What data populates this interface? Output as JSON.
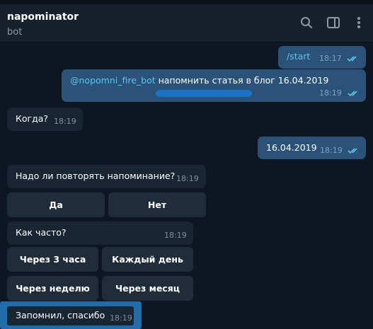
{
  "header": {
    "title": "napominator",
    "subtitle": "bot"
  },
  "messages": [
    {
      "id": "m1",
      "dir": "out",
      "text": "/start",
      "time": "18:17"
    },
    {
      "id": "m2",
      "dir": "out",
      "mention": "@nopomni_fire_bot",
      "text": " напомнить статья в блог 16.04.2019",
      "time": "18:19"
    },
    {
      "id": "m3",
      "dir": "in",
      "text": "Когда?",
      "time": "18:19"
    },
    {
      "id": "m4",
      "dir": "out",
      "text": "16.04.2019",
      "time": "18:19"
    },
    {
      "id": "m5",
      "dir": "in",
      "text": "Надо ли повторять напоминание?",
      "time": "18:19"
    },
    {
      "id": "m6",
      "dir": "in",
      "text": "Как часто?",
      "time": "18:19"
    },
    {
      "id": "m7",
      "dir": "in",
      "text": "Запомнил, спасибо",
      "time": "18:19"
    }
  ],
  "keyboard1": [
    "Да",
    "Нет"
  ],
  "keyboard2": [
    "Через 3 часа",
    "Каждый день",
    "Через неделю",
    "Через месяц"
  ],
  "colors": {
    "background": "#0e1621",
    "header": "#17212b",
    "outgoing_bubble": "#2b5278",
    "incoming_bubble": "#182533",
    "button": "#1f2c3a",
    "accent": "#5ec3ec",
    "highlight": "#1f6dab"
  },
  "icons": [
    "search-icon",
    "sidebar-toggle-icon",
    "more-vertical-icon",
    "double-check-icon"
  ]
}
